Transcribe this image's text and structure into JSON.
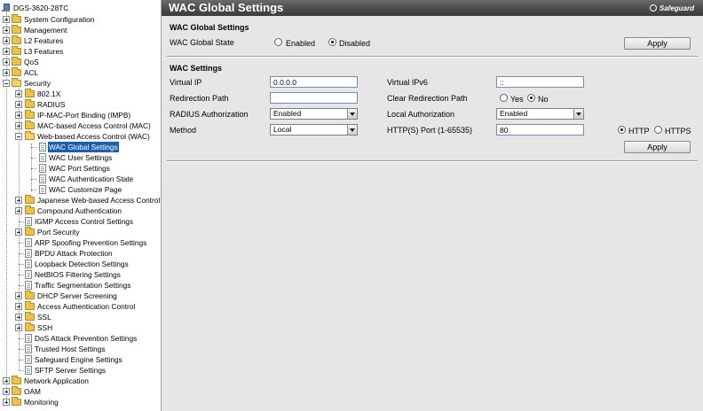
{
  "tree": {
    "root": "DGS-3620-28TC",
    "items": [
      "System Configuration",
      "Management",
      "L2 Features",
      "L3 Features",
      "QoS",
      "ACL",
      "Security",
      "802.1X",
      "RADIUS",
      "IP-MAC-Port Binding (IMPB)",
      "MAC-based Access Control (MAC)",
      "Web-based Access Control (WAC)",
      "WAC Global Settings",
      "WAC User Settings",
      "WAC Port Settings",
      "WAC Authentication State",
      "WAC Customize Page",
      "Japanese Web-based Access Control",
      "Compound Authentication",
      "IGMP Access Control Settings",
      "Port Security",
      "ARP Spoofing Prevention Settings",
      "BPDU Attack Protection",
      "Loopback Detection Settings",
      "NetBIOS Filtering Settings",
      "Traffic Segmentation Settings",
      "DHCP Server Screening",
      "Access Authentication Control",
      "SSL",
      "SSH",
      "DoS Attack Prevention Settings",
      "Trusted Host Settings",
      "Safeguard Engine Settings",
      "SFTP Server Settings",
      "Network Application",
      "OAM",
      "Monitoring"
    ]
  },
  "header": {
    "title": "WAC Global Settings",
    "safeguard": "Safeguard"
  },
  "global": {
    "heading": "WAC Global Settings",
    "state_label": "WAC Global State",
    "enabled": "Enabled",
    "disabled": "Disabled",
    "apply": "Apply"
  },
  "settings": {
    "heading": "WAC Settings",
    "virtual_ip_label": "Virtual IP",
    "virtual_ip": "0.0.0.0",
    "virtual_ipv6_label": "Virtual IPv6",
    "virtual_ipv6": "::",
    "redirection_label": "Redirection Path",
    "redirection": "",
    "clear_redirection_label": "Clear Redirection Path",
    "yes": "Yes",
    "no": "No",
    "radius_label": "RADIUS Authorization",
    "radius": "Enabled",
    "local_label": "Local Authorization",
    "local": "Enabled",
    "method_label": "Method",
    "method": "Local",
    "port_label": "HTTP(S) Port (1-65535)",
    "port": "80",
    "http": "HTTP",
    "https": "HTTPS",
    "apply": "Apply"
  }
}
